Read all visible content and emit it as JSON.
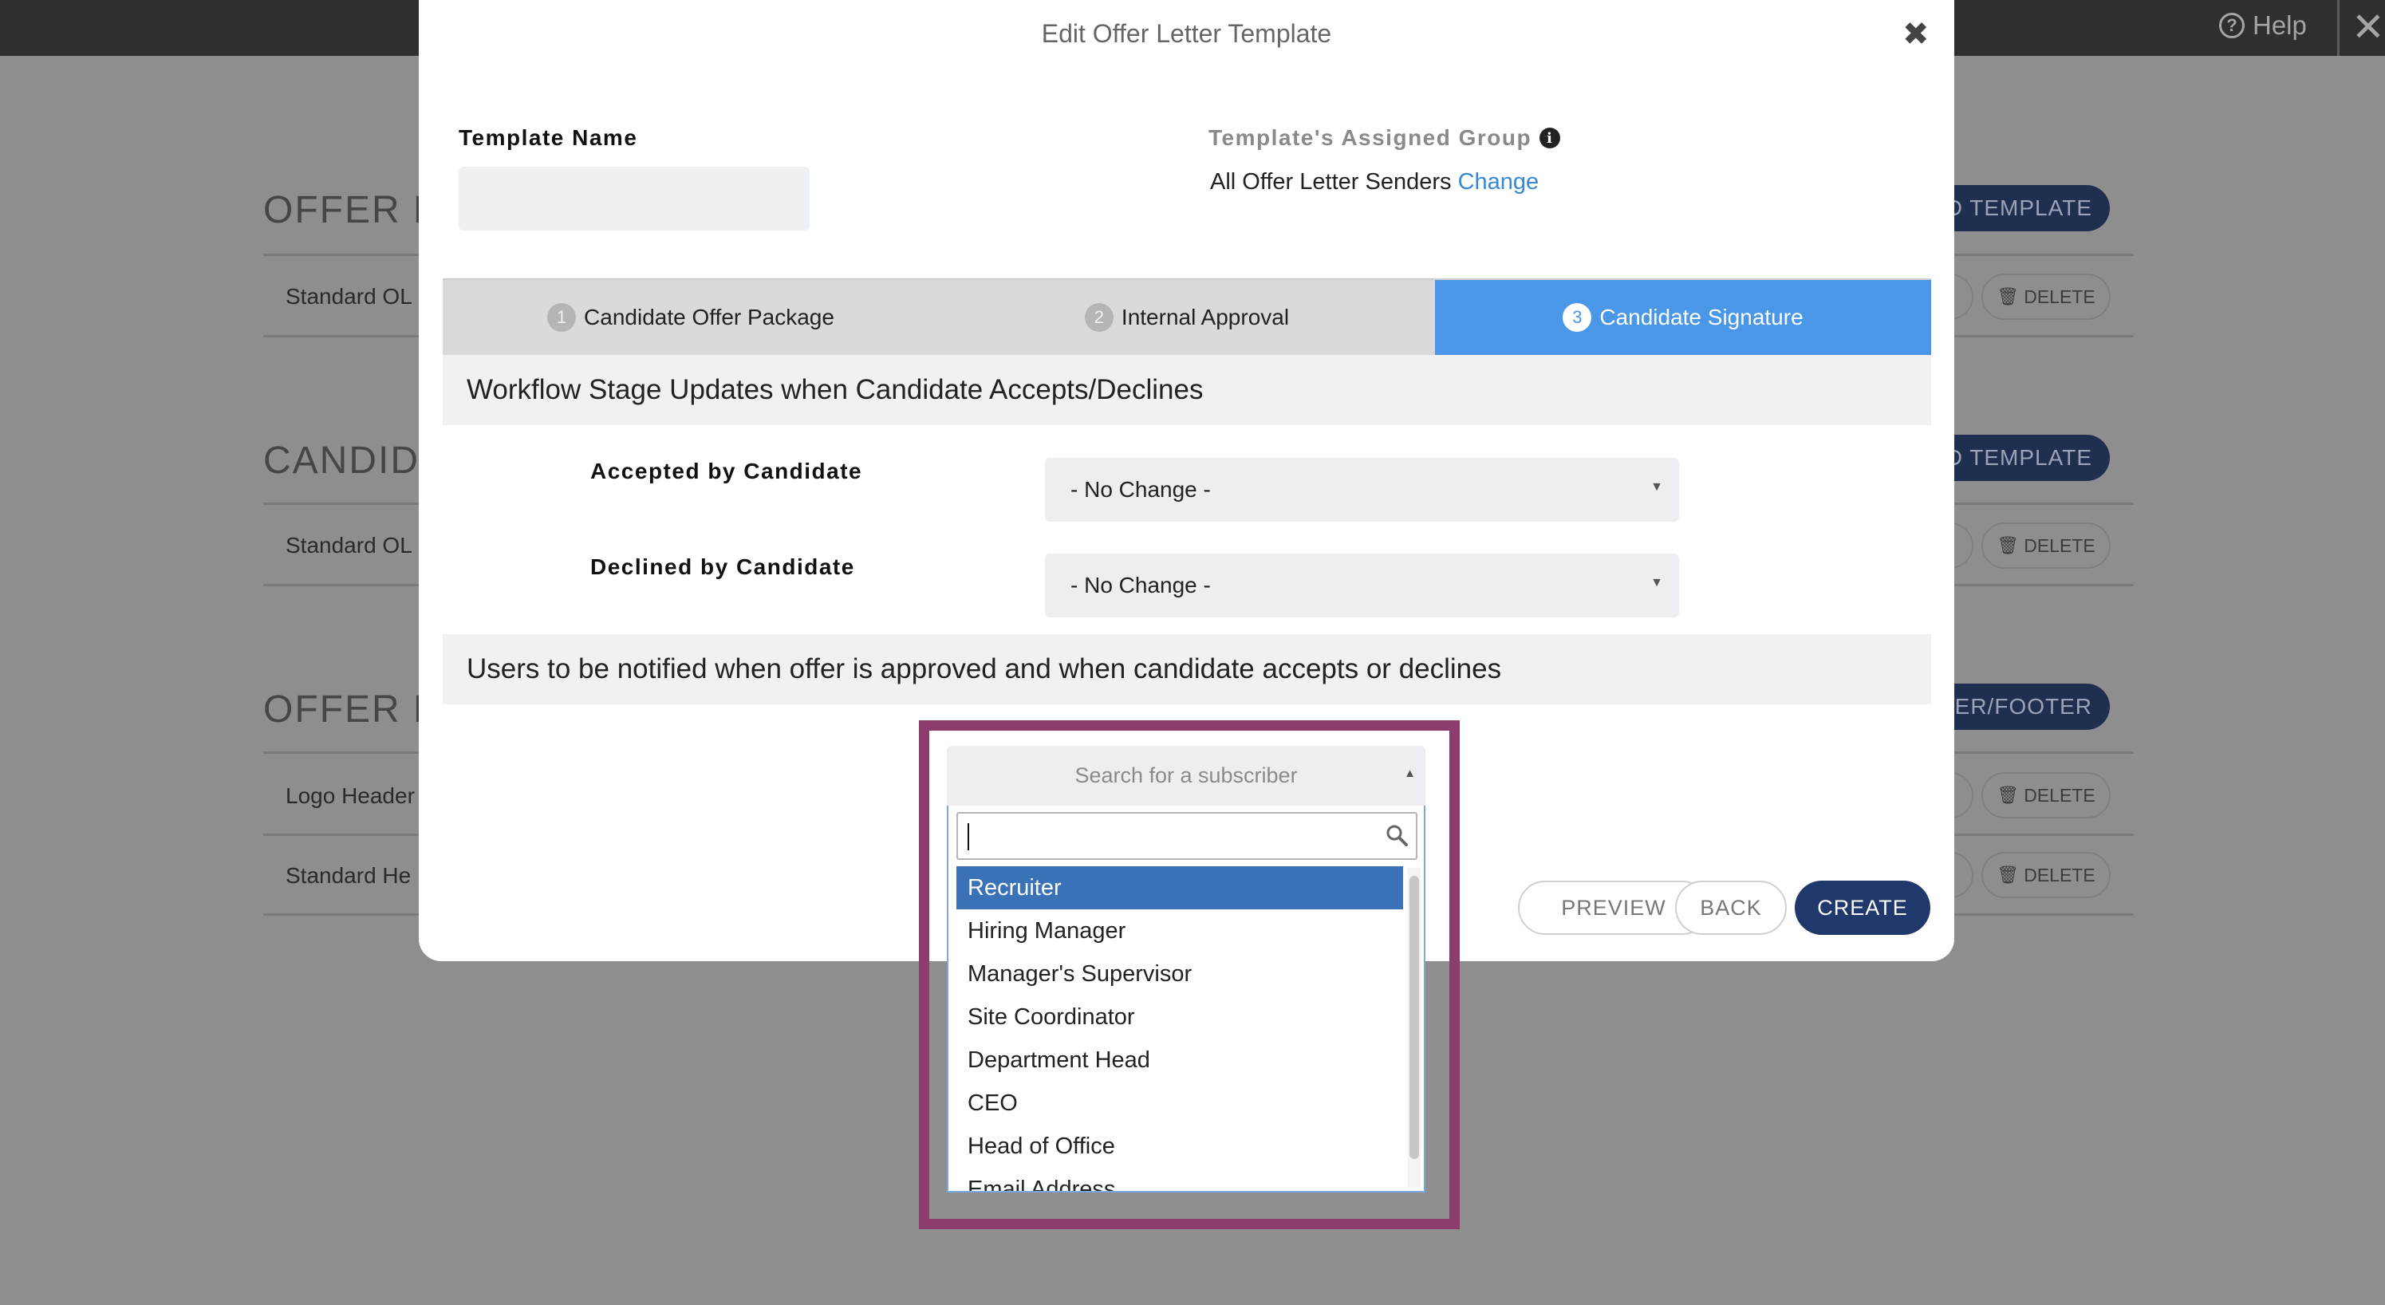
{
  "topbar": {
    "help_label": "Help",
    "help_icon": "question-circle-icon",
    "close_icon": "close-icon"
  },
  "background": {
    "sections": [
      {
        "title": "OFFER LE",
        "action": "D TEMPLATE",
        "rows": [
          "Standard OL"
        ]
      },
      {
        "title": "CANDIDA",
        "action": "D TEMPLATE",
        "rows": [
          "Standard OL"
        ]
      },
      {
        "title": "OFFER LE",
        "action": "ADER/FOOTER",
        "rows": [
          "Logo Header",
          "Standard He"
        ]
      }
    ],
    "delete_label": "DELETE",
    "delete_icon": "trash-icon"
  },
  "modal": {
    "title": "Edit Offer Letter Template",
    "close_icon": "close-icon",
    "template_name_label": "Template Name",
    "template_name_value": "",
    "assigned_group_label": "Template's Assigned Group",
    "assigned_group_value": "All Offer Letter Senders",
    "change_link": "Change",
    "tabs": [
      {
        "num": "1",
        "label": "Candidate Offer Package"
      },
      {
        "num": "2",
        "label": "Internal Approval"
      },
      {
        "num": "3",
        "label": "Candidate Signature"
      }
    ],
    "active_tab": 2,
    "workflow_heading": "Workflow Stage Updates when Candidate Accepts/Declines",
    "accepted_label": "Accepted by Candidate",
    "accepted_value": "- No Change -",
    "declined_label": "Declined by Candidate",
    "declined_value": "- No Change -",
    "notify_heading": "Users to be notified when offer is approved and when candidate accepts or declines",
    "subscriber_placeholder": "Search for a subscriber",
    "search_value": "",
    "subscriber_options": [
      "Recruiter",
      "Hiring Manager",
      "Manager's Supervisor",
      "Site Coordinator",
      "Department Head",
      "CEO",
      "Head of Office",
      "Email Address"
    ],
    "selected_option": "Recruiter",
    "buttons": {
      "preview": "PREVIEW",
      "back": "BACK",
      "create": "CREATE"
    },
    "colors": {
      "active_tab": "#4a97e8",
      "primary_button": "#20386b",
      "highlight_frame": "#8c3d6d",
      "selected_option": "#3a72b8",
      "link": "#3a87d6"
    }
  }
}
